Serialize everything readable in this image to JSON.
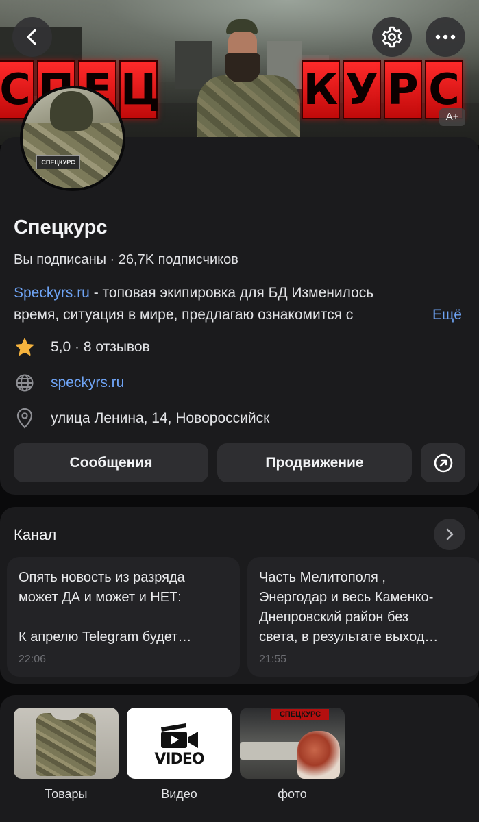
{
  "cover": {
    "left_word": "СПЕЦ",
    "right_word": "КУРС",
    "badge": "А+"
  },
  "profile": {
    "avatar_patch": "СПЕЦКУРС",
    "name": "Спецкурс",
    "subs_line": "Вы подписаны · 26,7K подписчиков",
    "desc_link": "Speckyrs.ru",
    "desc_rest": " - топовая экипировка для БД Изменилось",
    "desc_line2": "время, ситуация в мире, предлагаю ознакомится с",
    "more": "Ещё",
    "rating": "5,0 · 8 отзывов",
    "website": "speckyrs.ru",
    "address": "улица Ленина, 14, Новороссийск",
    "btn_messages": "Сообщения",
    "btn_promo": "Продвижение"
  },
  "channel": {
    "title": "Канал",
    "posts": [
      {
        "text": "Опять новость из разряда\nможет ДА и может и НЕТ:\n\nК апрелю Telegram будет…",
        "time": "22:06"
      },
      {
        "text": "Часть Мелитополя ,\nЭнергодар и весь Каменко-\nДнепровский район без\nсвета, в результате выход…",
        "time": "21:55"
      }
    ]
  },
  "media": {
    "items": [
      {
        "label": "Товары"
      },
      {
        "label": "Видео",
        "thumb_text": "VIDEO"
      },
      {
        "label": "фото",
        "banner": "СПЕЦКУРС"
      }
    ]
  },
  "colors": {
    "background": "#0a0a0b",
    "card": "#1b1b1d",
    "button": "#2e2e31",
    "link": "#6ea3f4",
    "star": "#f5b33e"
  }
}
